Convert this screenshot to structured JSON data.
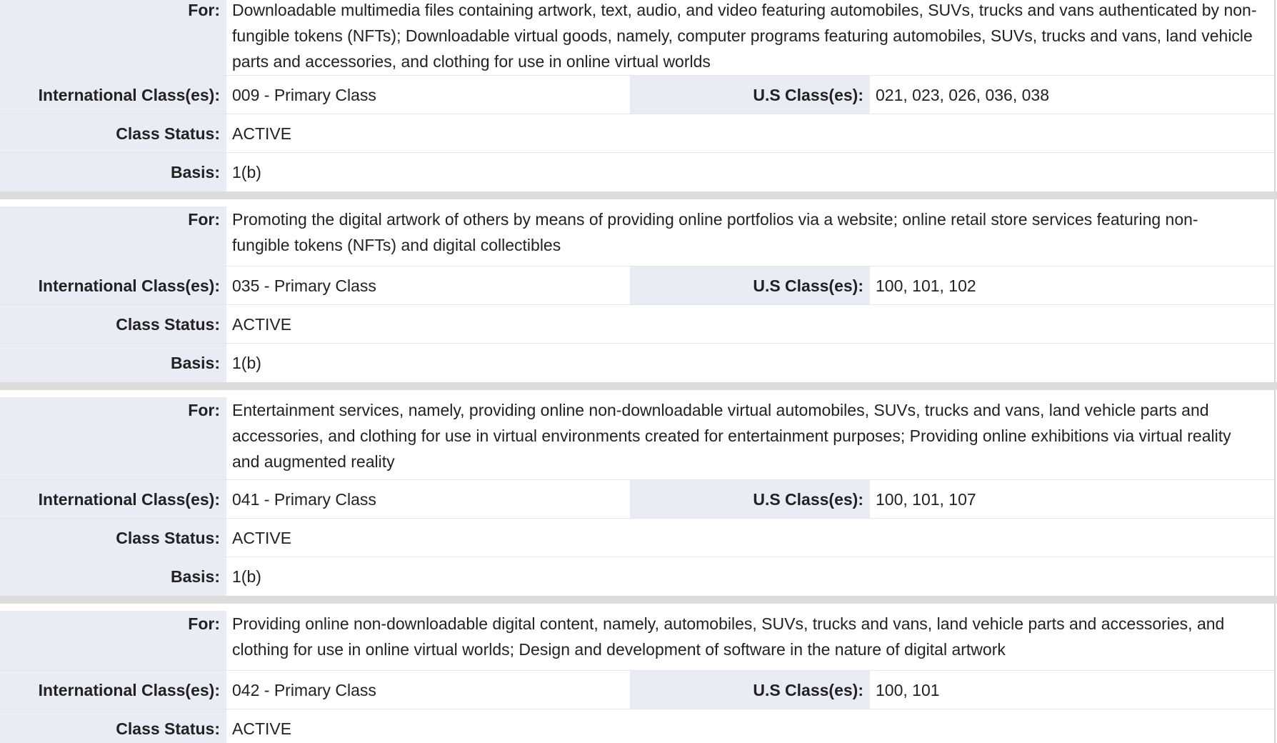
{
  "labels": {
    "for": "For:",
    "international": "International Class(es):",
    "us": "U.S Class(es):",
    "status": "Class Status:",
    "basis": "Basis:"
  },
  "entries": [
    {
      "for": "Downloadable multimedia files containing artwork, text, audio, and video featuring automobiles, SUVs, trucks and vans authenticated by non-fungible tokens (NFTs); Downloadable virtual goods, namely, computer programs featuring automobiles, SUVs, trucks and vans, land vehicle parts and accessories, and clothing for use in online virtual worlds",
      "international": "009 - Primary Class",
      "us": "021, 023, 026, 036, 038",
      "status": "ACTIVE",
      "basis": "1(b)"
    },
    {
      "for": "Promoting the digital artwork of others by means of providing online portfolios via a website; online retail store services featuring non-fungible tokens (NFTs) and digital collectibles",
      "international": "035 - Primary Class",
      "us": "100, 101, 102",
      "status": "ACTIVE",
      "basis": "1(b)"
    },
    {
      "for": "Entertainment services, namely, providing online non-downloadable virtual automobiles, SUVs, trucks and vans, land vehicle parts and accessories, and clothing for use in virtual environments created for entertainment purposes; Providing online exhibitions via virtual reality and augmented reality",
      "international": "041 - Primary Class",
      "us": "100, 101, 107",
      "status": "ACTIVE",
      "basis": "1(b)"
    },
    {
      "for": "Providing online non-downloadable digital content, namely, automobiles, SUVs, trucks and vans, land vehicle parts and accessories, and clothing for use in online virtual worlds; Design and development of software in the nature of digital artwork",
      "international": "042 - Primary Class",
      "us": "100, 101",
      "status": "ACTIVE",
      "basis": ""
    }
  ]
}
